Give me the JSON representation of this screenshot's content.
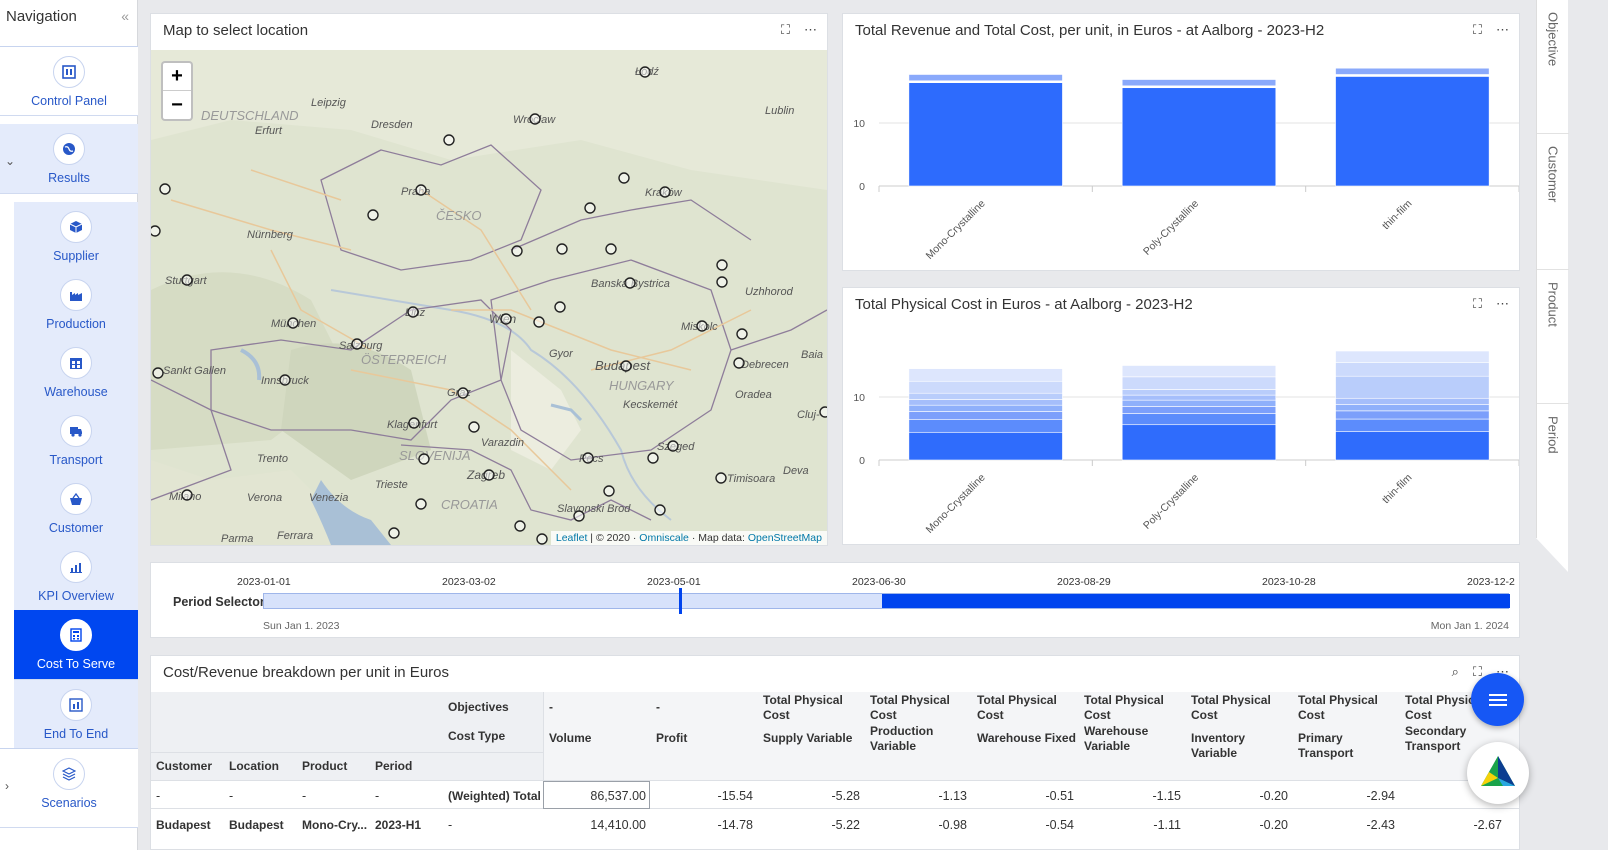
{
  "nav": {
    "title": "Navigation",
    "collapse_icon": "«",
    "items": [
      {
        "label": "Control Panel",
        "icon": "control-panel-icon"
      },
      {
        "label": "Results",
        "icon": "globe-icon"
      },
      {
        "label": "Supplier",
        "icon": "box-icon"
      },
      {
        "label": "Production",
        "icon": "factory-icon"
      },
      {
        "label": "Warehouse",
        "icon": "warehouse-icon"
      },
      {
        "label": "Transport",
        "icon": "truck-icon"
      },
      {
        "label": "Customer",
        "icon": "basket-icon"
      },
      {
        "label": "KPI Overview",
        "icon": "bar-chart-icon"
      },
      {
        "label": "Cost To Serve",
        "icon": "calculator-icon"
      },
      {
        "label": "End To End",
        "icon": "end-to-end-icon"
      },
      {
        "label": "Scenarios",
        "icon": "layers-icon"
      }
    ],
    "active": "Cost To Serve"
  },
  "map_panel": {
    "title": "Map to select location",
    "zoom_in": "+",
    "zoom_out": "−",
    "attribution_leaflet": "Leaflet",
    "attribution_sep": " | © 2020 · ",
    "attribution_omniscale": "Omniscale",
    "attribution_mid": " · Map data: ",
    "attribution_osm": "OpenStreetMap",
    "places": [
      {
        "name": "Leipzig"
      },
      {
        "name": "Dresden"
      },
      {
        "name": "Erfurt"
      },
      {
        "name": "DEUTSCHLAND"
      },
      {
        "name": "Praha"
      },
      {
        "name": "ČESKO"
      },
      {
        "name": "Nürnberg"
      },
      {
        "name": "Stuttgart"
      },
      {
        "name": "München"
      },
      {
        "name": "Salzburg"
      },
      {
        "name": "ÖSTERREICH"
      },
      {
        "name": "Innsbruck"
      },
      {
        "name": "Sankt Gallen"
      },
      {
        "name": "Linz"
      },
      {
        "name": "Wien"
      },
      {
        "name": "Gyor"
      },
      {
        "name": "Budapest"
      },
      {
        "name": "HUNGARY"
      },
      {
        "name": "Kecskemét"
      },
      {
        "name": "Graz"
      },
      {
        "name": "Klagenfurt"
      },
      {
        "name": "Varazdin"
      },
      {
        "name": "SLOVENIJA"
      },
      {
        "name": "Zagreb"
      },
      {
        "name": "Trento"
      },
      {
        "name": "Trieste"
      },
      {
        "name": "Verona"
      },
      {
        "name": "Venezia"
      },
      {
        "name": "Milano"
      },
      {
        "name": "Parma"
      },
      {
        "name": "Ferrara"
      },
      {
        "name": "CROATIA"
      },
      {
        "name": "Slavonski Brod"
      },
      {
        "name": "Pécs"
      },
      {
        "name": "Szeged"
      },
      {
        "name": "Timisoara"
      },
      {
        "name": "Deva"
      },
      {
        "name": "Oradea"
      },
      {
        "name": "Debrecen"
      },
      {
        "name": "Miskolc"
      },
      {
        "name": "Banská Bystrica"
      },
      {
        "name": "Uzhhorod"
      },
      {
        "name": "Kraków"
      },
      {
        "name": "Wrocław"
      },
      {
        "name": "Łódź"
      },
      {
        "name": "Lublin"
      },
      {
        "name": "Cluj-"
      },
      {
        "name": "Baia"
      }
    ]
  },
  "revenue_chart": {
    "title": "Total Revenue and Total Cost, per unit, in Euros - at Aalborg - 2023-H2",
    "yticks": [
      "0",
      "10"
    ],
    "categories": [
      "Mono-Crystalline",
      "Poly-Crystalline",
      "thin-film"
    ]
  },
  "physical_chart": {
    "title": "Total Physical Cost in Euros - at Aalborg - 2023-H2",
    "yticks": [
      "0",
      "10"
    ],
    "categories": [
      "Mono-Crystalline",
      "Poly-Crystalline",
      "thin-film"
    ]
  },
  "chart_data": [
    {
      "type": "bar",
      "title": "Total Revenue and Total Cost, per unit, in Euros - at Aalborg - 2023-H2",
      "categories": [
        "Mono-Crystalline",
        "Poly-Crystalline",
        "thin-film"
      ],
      "ylim": [
        0,
        20
      ],
      "series": [
        {
          "values": [
            16.4,
            15.6,
            17.4
          ]
        },
        {
          "values": [
            0.3,
            0.3,
            0.3
          ]
        },
        {
          "values": [
            1.0,
            1.0,
            1.0
          ]
        }
      ]
    },
    {
      "type": "bar",
      "title": "Total Physical Cost in Euros - at Aalborg - 2023-H2",
      "categories": [
        "Mono-Crystalline",
        "Poly-Crystalline",
        "thin-film"
      ],
      "ylim": [
        0,
        20
      ],
      "series": [
        {
          "values": [
            4.4,
            5.6,
            4.5
          ]
        },
        {
          "values": [
            2.0,
            1.8,
            2.0
          ]
        },
        {
          "values": [
            1.3,
            1.1,
            1.3
          ]
        },
        {
          "values": [
            1.0,
            1.0,
            1.0
          ]
        },
        {
          "values": [
            0.9,
            0.8,
            1.0
          ]
        },
        {
          "values": [
            1.0,
            0.9,
            3.5
          ]
        },
        {
          "values": [
            1.9,
            2.0,
            2.2
          ]
        },
        {
          "values": [
            2.0,
            1.8,
            1.8
          ]
        }
      ]
    }
  ],
  "right_tabs": [
    "Objective",
    "Customer",
    "Product",
    "Period"
  ],
  "period_selector": {
    "label": "Period Selector",
    "ticks": [
      "2023-01-01",
      "2023-03-02",
      "2023-05-01",
      "2023-06-30",
      "2023-08-29",
      "2023-10-28",
      "2023-12-2"
    ],
    "start_label": "Sun Jan 1. 2023",
    "end_label": "Mon Jan 1. 2024",
    "handle_date": "2023-05-01",
    "selected_from": "2023-07-01",
    "selected_to": "2024-01-01"
  },
  "table": {
    "title": "Cost/Revenue breakdown per unit in Euros",
    "row_labels": {
      "objectives": "Objectives",
      "cost_type": "Cost Type"
    },
    "dim_headers": [
      "Customer",
      "Location",
      "Product",
      "Period"
    ],
    "columns": [
      {
        "objective": "-",
        "cost_type": "Volume"
      },
      {
        "objective": "-",
        "cost_type": "Profit"
      },
      {
        "objective": "Total Physical Cost",
        "cost_type": "Supply Variable"
      },
      {
        "objective": "Total Physical Cost",
        "cost_type": "Production Variable"
      },
      {
        "objective": "Total Physical Cost",
        "cost_type": "Warehouse Fixed"
      },
      {
        "objective": "Total Physical Cost",
        "cost_type": "Warehouse Variable"
      },
      {
        "objective": "Total Physical Cost",
        "cost_type": "Inventory Variable"
      },
      {
        "objective": "Total Physical Cost",
        "cost_type": "Primary Transport"
      },
      {
        "objective": "Total Physical Cost",
        "cost_type": "Secondary Transport"
      }
    ],
    "rows": [
      {
        "dims": [
          "-",
          "-",
          "-",
          "-"
        ],
        "label": "(Weighted) Total",
        "values": [
          "86,537.00",
          "-15.54",
          "-5.28",
          "-1.13",
          "-0.51",
          "-1.15",
          "-0.20",
          "-2.94",
          "-"
        ]
      },
      {
        "dims": [
          "Budapest",
          "Budapest",
          "Mono-Cry...",
          "2023-H1"
        ],
        "label": "-",
        "values": [
          "14,410.00",
          "-14.78",
          "-5.22",
          "-0.98",
          "-0.54",
          "-1.11",
          "-0.20",
          "-2.43",
          "-2.67"
        ]
      }
    ]
  },
  "colors": {
    "accent": "#0044ee",
    "bar_primary": "#2d6bfd",
    "bar_light": "#b9cdfb"
  }
}
